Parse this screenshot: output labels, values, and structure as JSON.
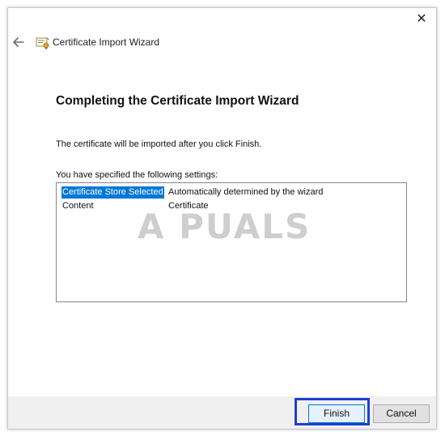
{
  "window": {
    "title": "Certificate Import Wizard",
    "close_glyph": "✕"
  },
  "page": {
    "heading": "Completing the Certificate Import Wizard",
    "info": "The certificate will be imported after you click Finish.",
    "settings_label": "You have specified the following settings:"
  },
  "settings": [
    {
      "key": "Certificate Store Selected",
      "value": "Automatically determined by the wizard",
      "selected": true
    },
    {
      "key": "Content",
      "value": "Certificate",
      "selected": false
    }
  ],
  "watermark": "A  PUALS",
  "buttons": {
    "finish": "Finish",
    "cancel": "Cancel"
  },
  "colors": {
    "selection": "#0078d7",
    "highlight_box": "#1f3fcf"
  },
  "icons": {
    "back": "back-arrow-icon",
    "certificate": "certificate-icon",
    "close": "close-icon"
  }
}
